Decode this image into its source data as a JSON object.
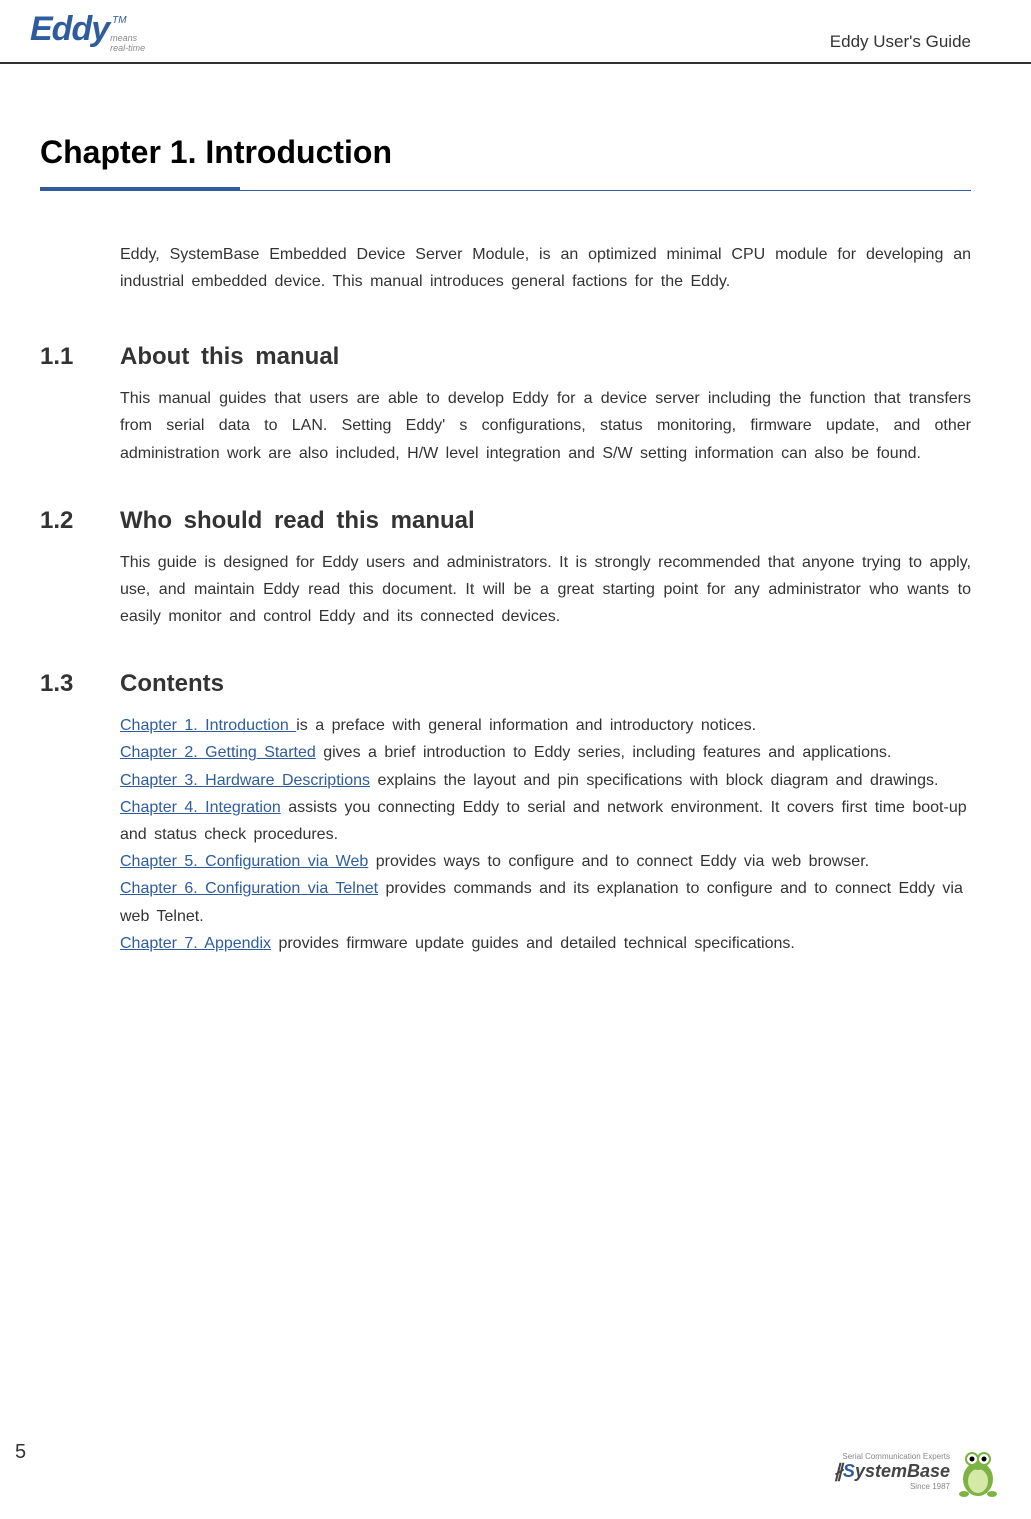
{
  "header": {
    "logo_main": "Eddy",
    "logo_tm": "TM",
    "logo_sub1": "means",
    "logo_sub2": "real-time",
    "guide_title": "Eddy User's Guide"
  },
  "chapter": {
    "title": "Chapter 1.    Introduction",
    "intro": "Eddy, SystemBase Embedded Device Server Module, is an optimized minimal CPU module for developing an industrial embedded device. This manual introduces general factions for the Eddy."
  },
  "sections": {
    "s1": {
      "num": "1.1",
      "title": "About this manual",
      "body": "This manual guides that users are able to develop Eddy for a device server including the function that transfers from serial data to LAN. Setting Eddy' s configurations, status monitoring, firmware update, and other administration work are also included, H/W level integration and S/W setting information can also be found."
    },
    "s2": {
      "num": "1.2",
      "title": "Who should read this manual",
      "body": "This guide is designed for Eddy users and administrators. It is strongly recommended that anyone trying to apply, use, and maintain Eddy read this document. It will be a great starting point for any administrator who wants to easily monitor and control Eddy and its connected devices."
    },
    "s3": {
      "num": "1.3",
      "title": "Contents"
    }
  },
  "contents": {
    "c1_link": "Chapter 1. Introduction ",
    "c1_text": " is a preface with general information and introductory notices.",
    "c2_link": "Chapter 2. Getting Started",
    "c2_text": " gives a brief introduction to Eddy series, including features and applications.",
    "c3_link": "Chapter 3. Hardware Descriptions",
    "c3_text": " explains the layout and pin specifications with block diagram and drawings.",
    "c4_link": "Chapter 4. Integration",
    "c4_text": " assists you connecting Eddy to serial and network environment. It covers first time boot-up and status check procedures.",
    "c5_link": "Chapter 5. Configuration via Web",
    "c5_text": " provides ways to configure and to connect Eddy via web browser.",
    "c6_link": "Chapter 6. Configuration via Telnet",
    "c6_text": " provides commands and its explanation to configure and to connect Eddy via web Telnet.",
    "c7_link": "Chapter 7. Appendix",
    "c7_text": " provides firmware update guides and detailed technical specifications."
  },
  "footer": {
    "page": "5",
    "tag": "Serial Communication Experts",
    "brand_accent": "S",
    "brand_rest": "ystemBase",
    "since": "Since 1987"
  }
}
